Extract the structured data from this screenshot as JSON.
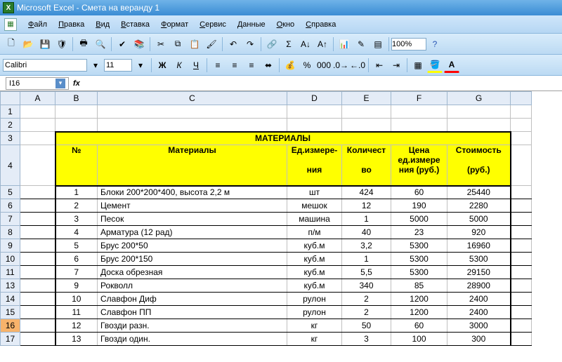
{
  "app": {
    "title": "Microsoft Excel - Смета на веранду 1"
  },
  "menu": {
    "items": [
      "Файл",
      "Правка",
      "Вид",
      "Вставка",
      "Формат",
      "Сервис",
      "Данные",
      "Окно",
      "Справка"
    ]
  },
  "toolbar": {
    "zoom": "100%"
  },
  "format": {
    "font": "Calibri",
    "size": "11"
  },
  "namebox": {
    "ref": "I16",
    "fx": "fx"
  },
  "columns": [
    "A",
    "B",
    "C",
    "D",
    "E",
    "F",
    "G",
    ""
  ],
  "rows_before": [
    "1",
    "2"
  ],
  "section": {
    "title": "МАТЕРИАЛЫ",
    "headers": {
      "num": "№",
      "material": "Материалы",
      "unit_top": "Ед.измере-",
      "unit_bot": "ния",
      "qty_top": "Количест",
      "qty_bot": "во",
      "price_top": "Цена",
      "price_mid": "ед.измере",
      "price_bot": "ния (руб.)",
      "cost_top": "Стоимость",
      "cost_bot": "(руб.)"
    },
    "header_rownums": [
      "3",
      "4"
    ]
  },
  "data": [
    {
      "rn": "5",
      "n": "1",
      "name": "Блоки 200*200*400, высота 2,2 м",
      "unit": "шт",
      "qty": "424",
      "price": "60",
      "cost": "25440"
    },
    {
      "rn": "6",
      "n": "2",
      "name": "Цемент",
      "unit": "мешок",
      "qty": "12",
      "price": "190",
      "cost": "2280"
    },
    {
      "rn": "7",
      "n": "3",
      "name": "Песок",
      "unit": "машина",
      "qty": "1",
      "price": "5000",
      "cost": "5000"
    },
    {
      "rn": "8",
      "n": "4",
      "name": "Арматура (12 рад)",
      "unit": "п/м",
      "qty": "40",
      "price": "23",
      "cost": "920"
    },
    {
      "rn": "9",
      "n": "5",
      "name": "Брус 200*50",
      "unit": "куб.м",
      "qty": "3,2",
      "price": "5300",
      "cost": "16960"
    },
    {
      "rn": "10",
      "n": "6",
      "name": "Брус 200*150",
      "unit": "куб.м",
      "qty": "1",
      "price": "5300",
      "cost": "5300"
    },
    {
      "rn": "11",
      "n": "7",
      "name": "Доска обрезная",
      "unit": "куб.м",
      "qty": "5,5",
      "price": "5300",
      "cost": "29150"
    },
    {
      "rn": "13",
      "n": "9",
      "name": "Рокволл",
      "unit": "куб.м",
      "qty": "340",
      "price": "85",
      "cost": "28900"
    },
    {
      "rn": "14",
      "n": "10",
      "name": "Славфон Диф",
      "unit": "рулон",
      "qty": "2",
      "price": "1200",
      "cost": "2400"
    },
    {
      "rn": "15",
      "n": "11",
      "name": "Славфон ПП",
      "unit": "рулон",
      "qty": "2",
      "price": "1200",
      "cost": "2400"
    },
    {
      "rn": "16",
      "n": "12",
      "name": "Гвозди разн.",
      "unit": "кг",
      "qty": "50",
      "price": "60",
      "cost": "3000",
      "selected": true
    },
    {
      "rn": "17",
      "n": "13",
      "name": "Гвозди один.",
      "unit": "кг",
      "qty": "3",
      "price": "100",
      "cost": "300"
    }
  ]
}
